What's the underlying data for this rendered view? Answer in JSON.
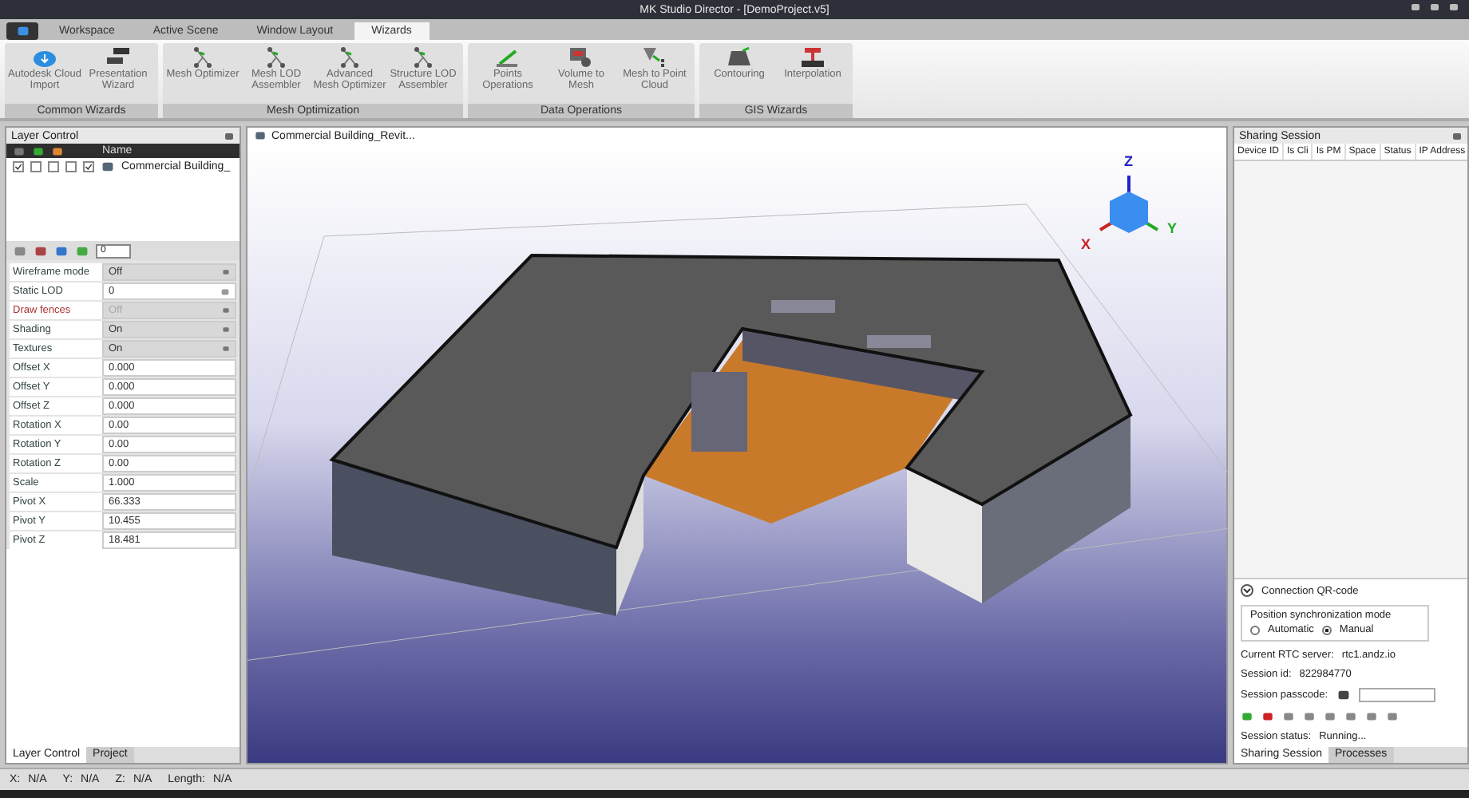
{
  "window": {
    "title": "MK Studio Director - [DemoProject.v5]"
  },
  "menu_tabs": [
    {
      "label": "Workspace",
      "selected": false
    },
    {
      "label": "Active Scene",
      "selected": false
    },
    {
      "label": "Window Layout",
      "selected": false
    },
    {
      "label": "Wizards",
      "selected": true
    }
  ],
  "ribbon_groups": [
    {
      "title": "Common Wizards",
      "buttons": [
        {
          "label": "Autodesk Cloud Import"
        },
        {
          "label": "Presentation Wizard"
        }
      ]
    },
    {
      "title": "Mesh Optimization",
      "buttons": [
        {
          "label": "Mesh Optimizer"
        },
        {
          "label": "Mesh LOD Assembler"
        },
        {
          "label": "Advanced Mesh Optimizer"
        },
        {
          "label": "Structure LOD Assembler"
        }
      ]
    },
    {
      "title": "Data Operations",
      "buttons": [
        {
          "label": "Points Operations"
        },
        {
          "label": "Volume to Mesh"
        },
        {
          "label": "Mesh to Point Cloud"
        }
      ]
    },
    {
      "title": "GIS Wizards",
      "buttons": [
        {
          "label": "Contouring"
        },
        {
          "label": "Interpolation"
        }
      ]
    }
  ],
  "layer_panel": {
    "title": "Layer Control",
    "column": "Name",
    "layers": [
      {
        "name": "Commercial Building_",
        "flags": [
          true,
          false,
          false,
          false,
          true
        ]
      }
    ],
    "lod_value": "0",
    "properties": [
      {
        "name": "Wireframe mode",
        "value": "Off",
        "kind": "dropdown",
        "disabled": false
      },
      {
        "name": "Static LOD",
        "value": "0",
        "kind": "spin",
        "disabled": false
      },
      {
        "name": "Draw fences",
        "value": "Off",
        "kind": "dropdown",
        "disabled": true
      },
      {
        "name": "Shading",
        "value": "On",
        "kind": "dropdown",
        "disabled": false
      },
      {
        "name": "Textures",
        "value": "On",
        "kind": "dropdown",
        "disabled": false
      },
      {
        "name": "Offset X",
        "value": "0.000",
        "kind": "text",
        "disabled": false
      },
      {
        "name": "Offset Y",
        "value": "0.000",
        "kind": "text",
        "disabled": false
      },
      {
        "name": "Offset Z",
        "value": "0.000",
        "kind": "text",
        "disabled": false
      },
      {
        "name": "Rotation X",
        "value": "0.00",
        "kind": "text",
        "disabled": false
      },
      {
        "name": "Rotation Y",
        "value": "0.00",
        "kind": "text",
        "disabled": false
      },
      {
        "name": "Rotation Z",
        "value": "0.00",
        "kind": "text",
        "disabled": false
      },
      {
        "name": "Scale",
        "value": "1.000",
        "kind": "text",
        "disabled": false
      },
      {
        "name": "Pivot X",
        "value": "66.333",
        "kind": "text",
        "disabled": false
      },
      {
        "name": "Pivot Y",
        "value": "10.455",
        "kind": "text",
        "disabled": false
      },
      {
        "name": "Pivot Z",
        "value": "18.481",
        "kind": "text",
        "disabled": false
      }
    ],
    "tabs": [
      {
        "label": "Layer Control",
        "selected": true
      },
      {
        "label": "Project",
        "selected": false
      }
    ]
  },
  "viewport": {
    "tab": "Commercial Building_Revit...",
    "axes": [
      "Z",
      "Y",
      "X"
    ]
  },
  "sharing_panel": {
    "title": "Sharing Session",
    "columns": [
      "Device ID",
      "Is Cli",
      "Is PM",
      "Space",
      "Status",
      "IP Address"
    ],
    "qr_section": {
      "label": "Connection QR-code",
      "expanded": false
    },
    "sync_mode": {
      "title": "Position synchronization mode",
      "options": [
        {
          "label": "Automatic",
          "selected": false
        },
        {
          "label": "Manual",
          "selected": true
        }
      ]
    },
    "server_label": "Current RTC server:",
    "server": "rtc1.andz.io",
    "session_label": "Session id:",
    "session_id": "822984770",
    "passcode_label": "Session passcode:",
    "status_label": "Session status:",
    "status": "Running...",
    "tabs": [
      {
        "label": "Sharing Session",
        "selected": true
      },
      {
        "label": "Processes",
        "selected": false
      }
    ]
  },
  "status_bar": [
    {
      "label": "X:",
      "value": "N/A"
    },
    {
      "label": "Y:",
      "value": "N/A"
    },
    {
      "label": "Z:",
      "value": "N/A"
    },
    {
      "label": "Length:",
      "value": "N/A"
    }
  ]
}
